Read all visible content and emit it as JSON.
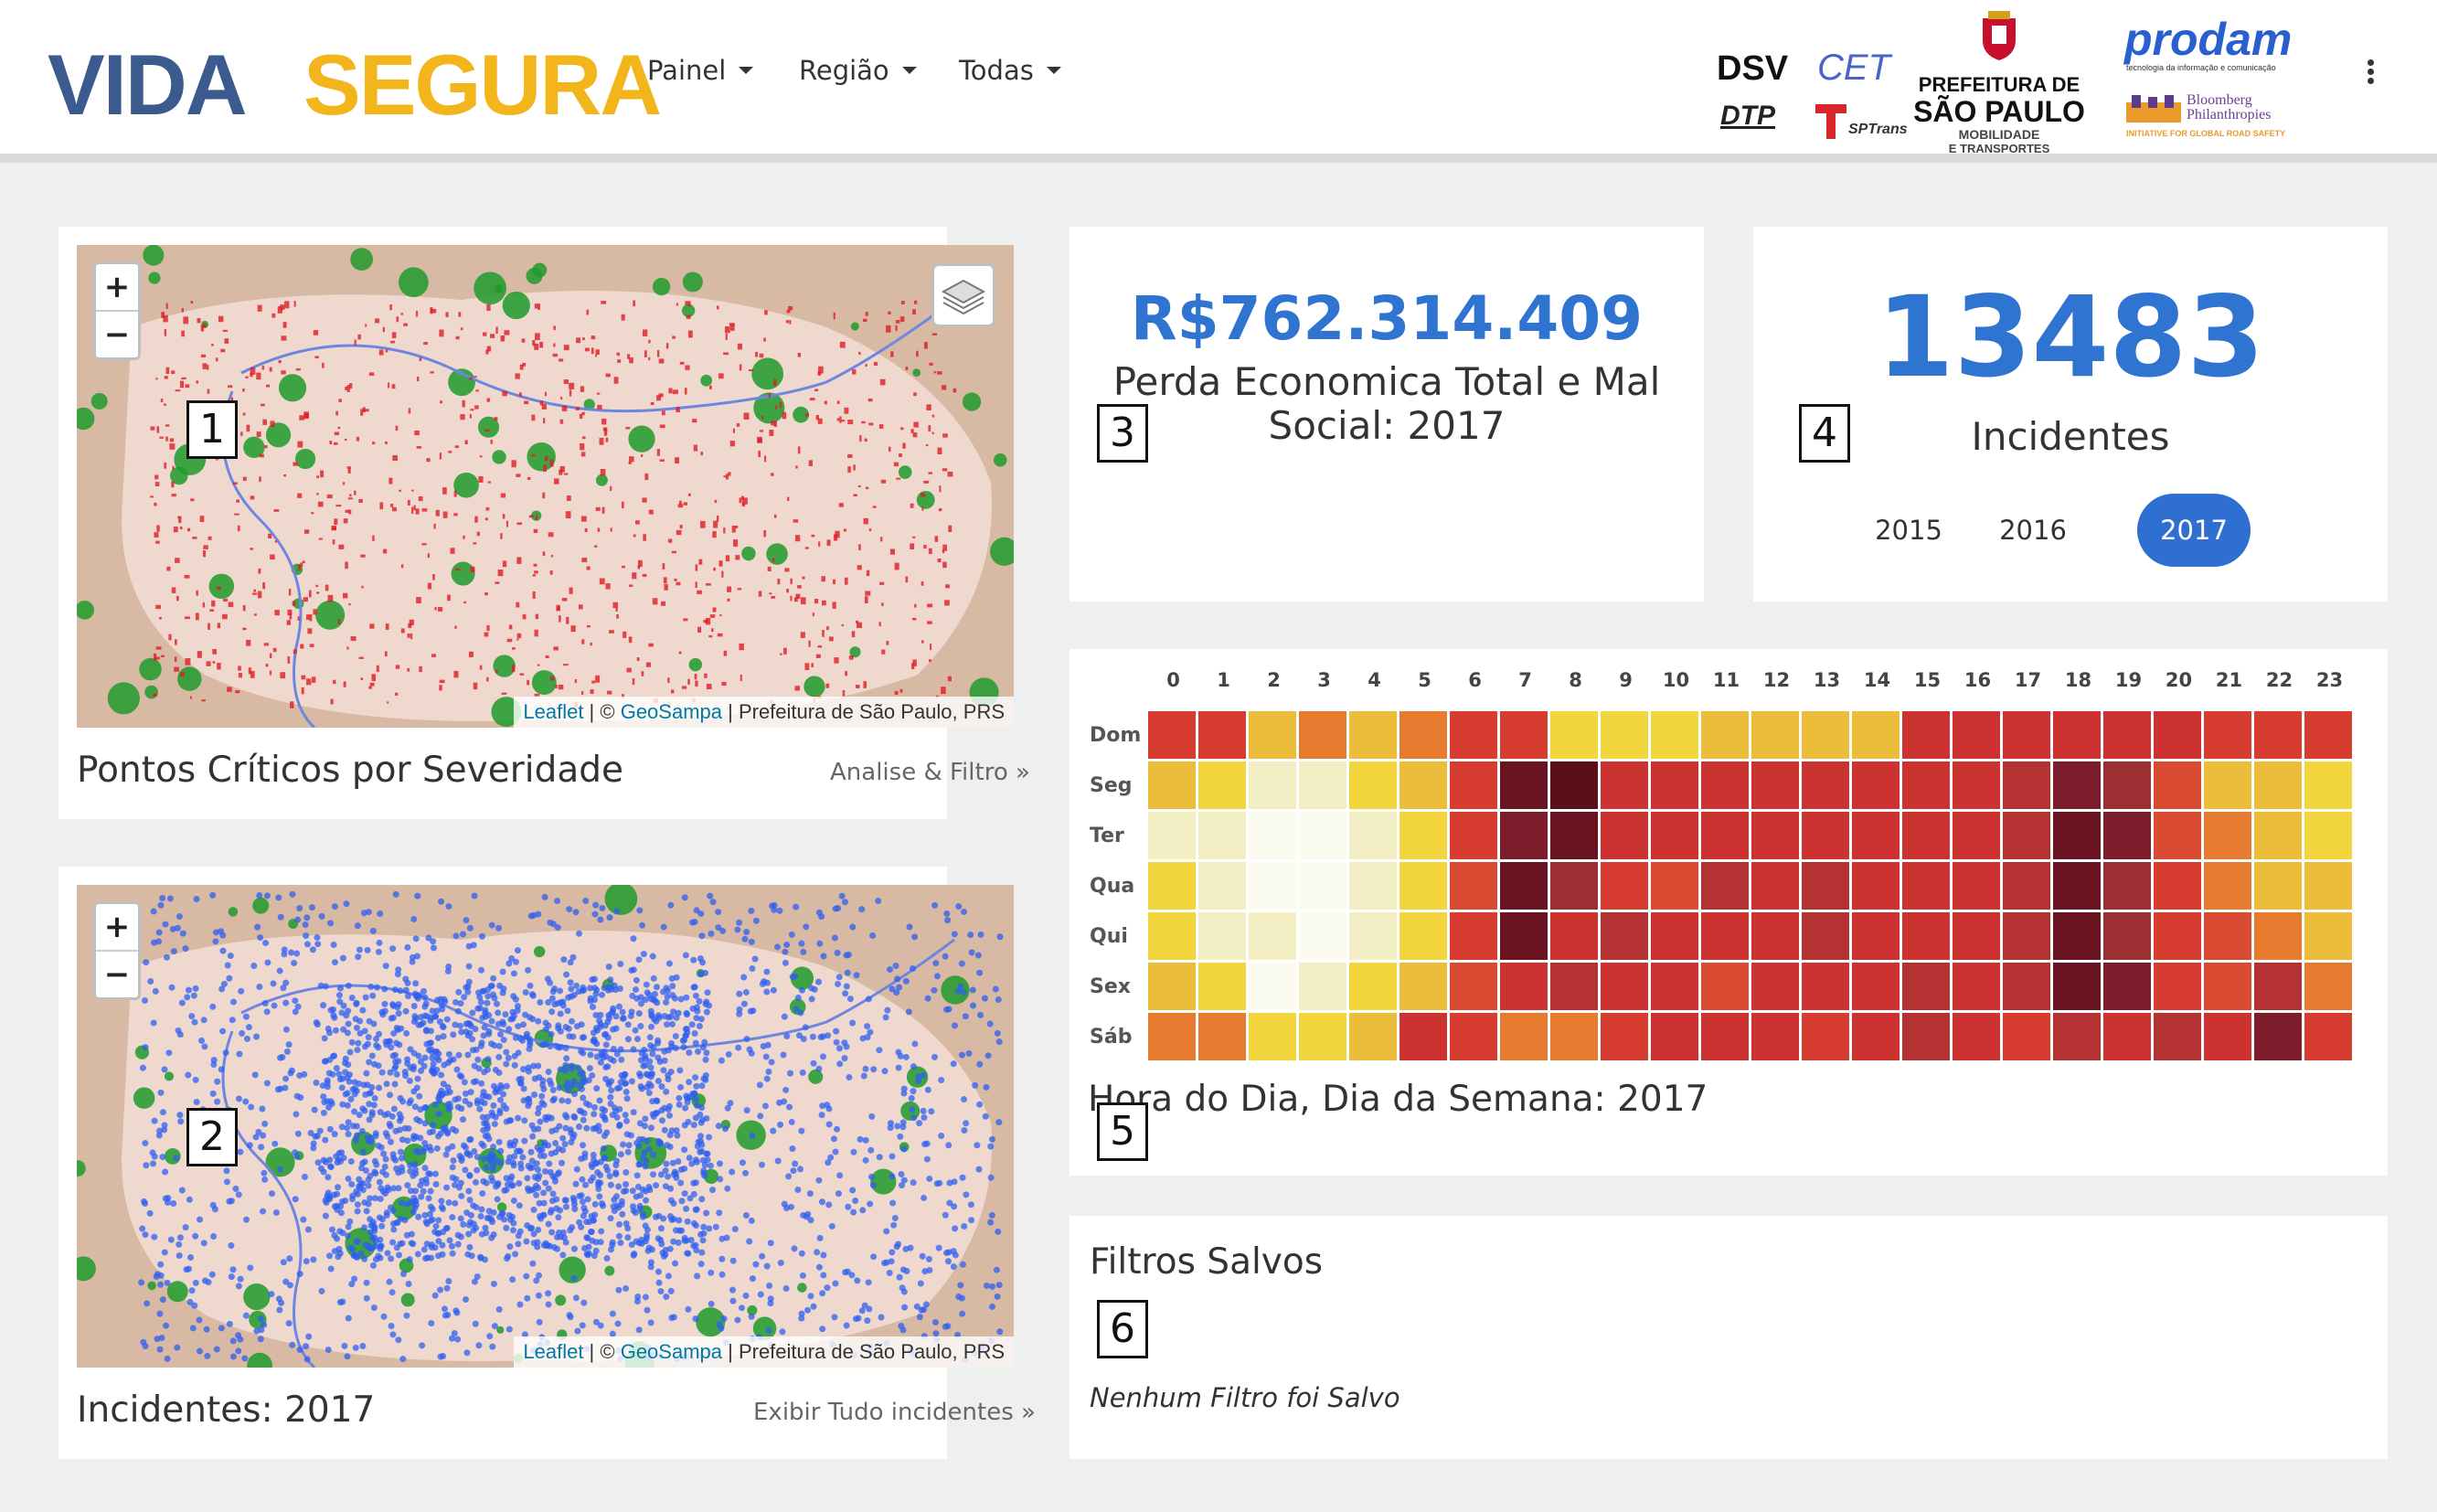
{
  "header": {
    "logo_vida": "VIDA",
    "logo_segura": "SEGURA",
    "menus": [
      "Painel",
      "Região",
      "Todas"
    ],
    "partners": {
      "dsv": "DSV",
      "cet": "CET",
      "dtp": "DTP",
      "sptrans": "SPTrans",
      "prefeitura_1": "PREFEITURA DE",
      "prefeitura_2": "SÃO PAULO",
      "prefeitura_3": "MOBILIDADE",
      "prefeitura_4": "E TRANSPORTES",
      "prodam": "prodam",
      "prodam_tag": "tecnologia da informação e comunicação",
      "bloomberg_1": "Bloomberg",
      "bloomberg_2": "Philanthropies",
      "bloomberg_tag": "INITIATIVE FOR GLOBAL ROAD SAFETY"
    }
  },
  "cards": {
    "map1": {
      "title": "Pontos Críticos por Severidade",
      "link": "Analise & Filtro »",
      "number": "1",
      "attrib_leaflet": "Leaflet",
      "attrib_sep": " | © ",
      "attrib_geosampa": "GeoSampa",
      "attrib_rest": " | Prefeitura de São Paulo, PRS"
    },
    "map2": {
      "title": "Incidentes: 2017",
      "link": "Exibir Tudo incidentes »",
      "number": "2",
      "attrib_leaflet": "Leaflet",
      "attrib_sep": " | © ",
      "attrib_geosampa": "GeoSampa",
      "attrib_rest": " | Prefeitura de São Paulo, PRS"
    },
    "loss": {
      "amount": "R$762.314.409",
      "label_line1": "Perda Economica Total e Mal",
      "label_line2": "Social: 2017",
      "number": "3"
    },
    "incidents": {
      "count": "13483",
      "label": "Incidentes",
      "years": [
        "2015",
        "2016",
        "2017"
      ],
      "active_year": "2017",
      "number": "4"
    },
    "heatmap": {
      "title": "Hora do Dia, Dia da Semana: 2017",
      "number": "5"
    },
    "filters": {
      "title": "Filtros Salvos",
      "empty": "Nenhum Filtro foi Salvo",
      "number": "6"
    }
  },
  "chart_data": {
    "type": "heatmap",
    "title": "Hora do Dia, Dia da Semana: 2017",
    "x": [
      "0",
      "1",
      "2",
      "3",
      "4",
      "5",
      "6",
      "7",
      "8",
      "9",
      "10",
      "11",
      "12",
      "13",
      "14",
      "15",
      "16",
      "17",
      "18",
      "19",
      "20",
      "21",
      "22",
      "23"
    ],
    "y": [
      "Dom",
      "Seg",
      "Ter",
      "Qua",
      "Qui",
      "Sex",
      "Sáb"
    ],
    "color_scale": [
      "#fcfbf0",
      "#f4eec4",
      "#f7e370",
      "#f3d63e",
      "#ebbd3a",
      "#e77b30",
      "#d94a33",
      "#d73c31",
      "#cc3230",
      "#b43232",
      "#9b2f32",
      "#7d1c2a",
      "#6a1421",
      "#5a0f1a"
    ],
    "values": [
      [
        7,
        7,
        4,
        5,
        4,
        5,
        7,
        7,
        3,
        3,
        3,
        4,
        4,
        4,
        4,
        8,
        8,
        8,
        8,
        8,
        8,
        7,
        7,
        7
      ],
      [
        4,
        3,
        1,
        1,
        3,
        4,
        7,
        12,
        13,
        8,
        8,
        8,
        8,
        8,
        8,
        8,
        8,
        9,
        11,
        10,
        6,
        4,
        4,
        3
      ],
      [
        1,
        1,
        0,
        0,
        1,
        3,
        7,
        11,
        12,
        8,
        8,
        8,
        8,
        8,
        8,
        8,
        8,
        9,
        12,
        11,
        6,
        5,
        4,
        3
      ],
      [
        3,
        1,
        0,
        0,
        1,
        3,
        6,
        12,
        10,
        7,
        6,
        9,
        8,
        9,
        8,
        8,
        8,
        9,
        12,
        10,
        7,
        5,
        4,
        4
      ],
      [
        3,
        1,
        1,
        0,
        1,
        3,
        7,
        12,
        8,
        9,
        8,
        8,
        8,
        9,
        8,
        8,
        8,
        9,
        12,
        10,
        7,
        6,
        5,
        4
      ],
      [
        4,
        3,
        0,
        1,
        3,
        4,
        6,
        8,
        9,
        8,
        8,
        6,
        8,
        8,
        8,
        9,
        8,
        9,
        12,
        11,
        7,
        6,
        9,
        5
      ],
      [
        5,
        5,
        3,
        3,
        4,
        8,
        7,
        5,
        5,
        7,
        8,
        8,
        8,
        7,
        8,
        9,
        8,
        7,
        9,
        8,
        9,
        8,
        11,
        7
      ]
    ]
  }
}
